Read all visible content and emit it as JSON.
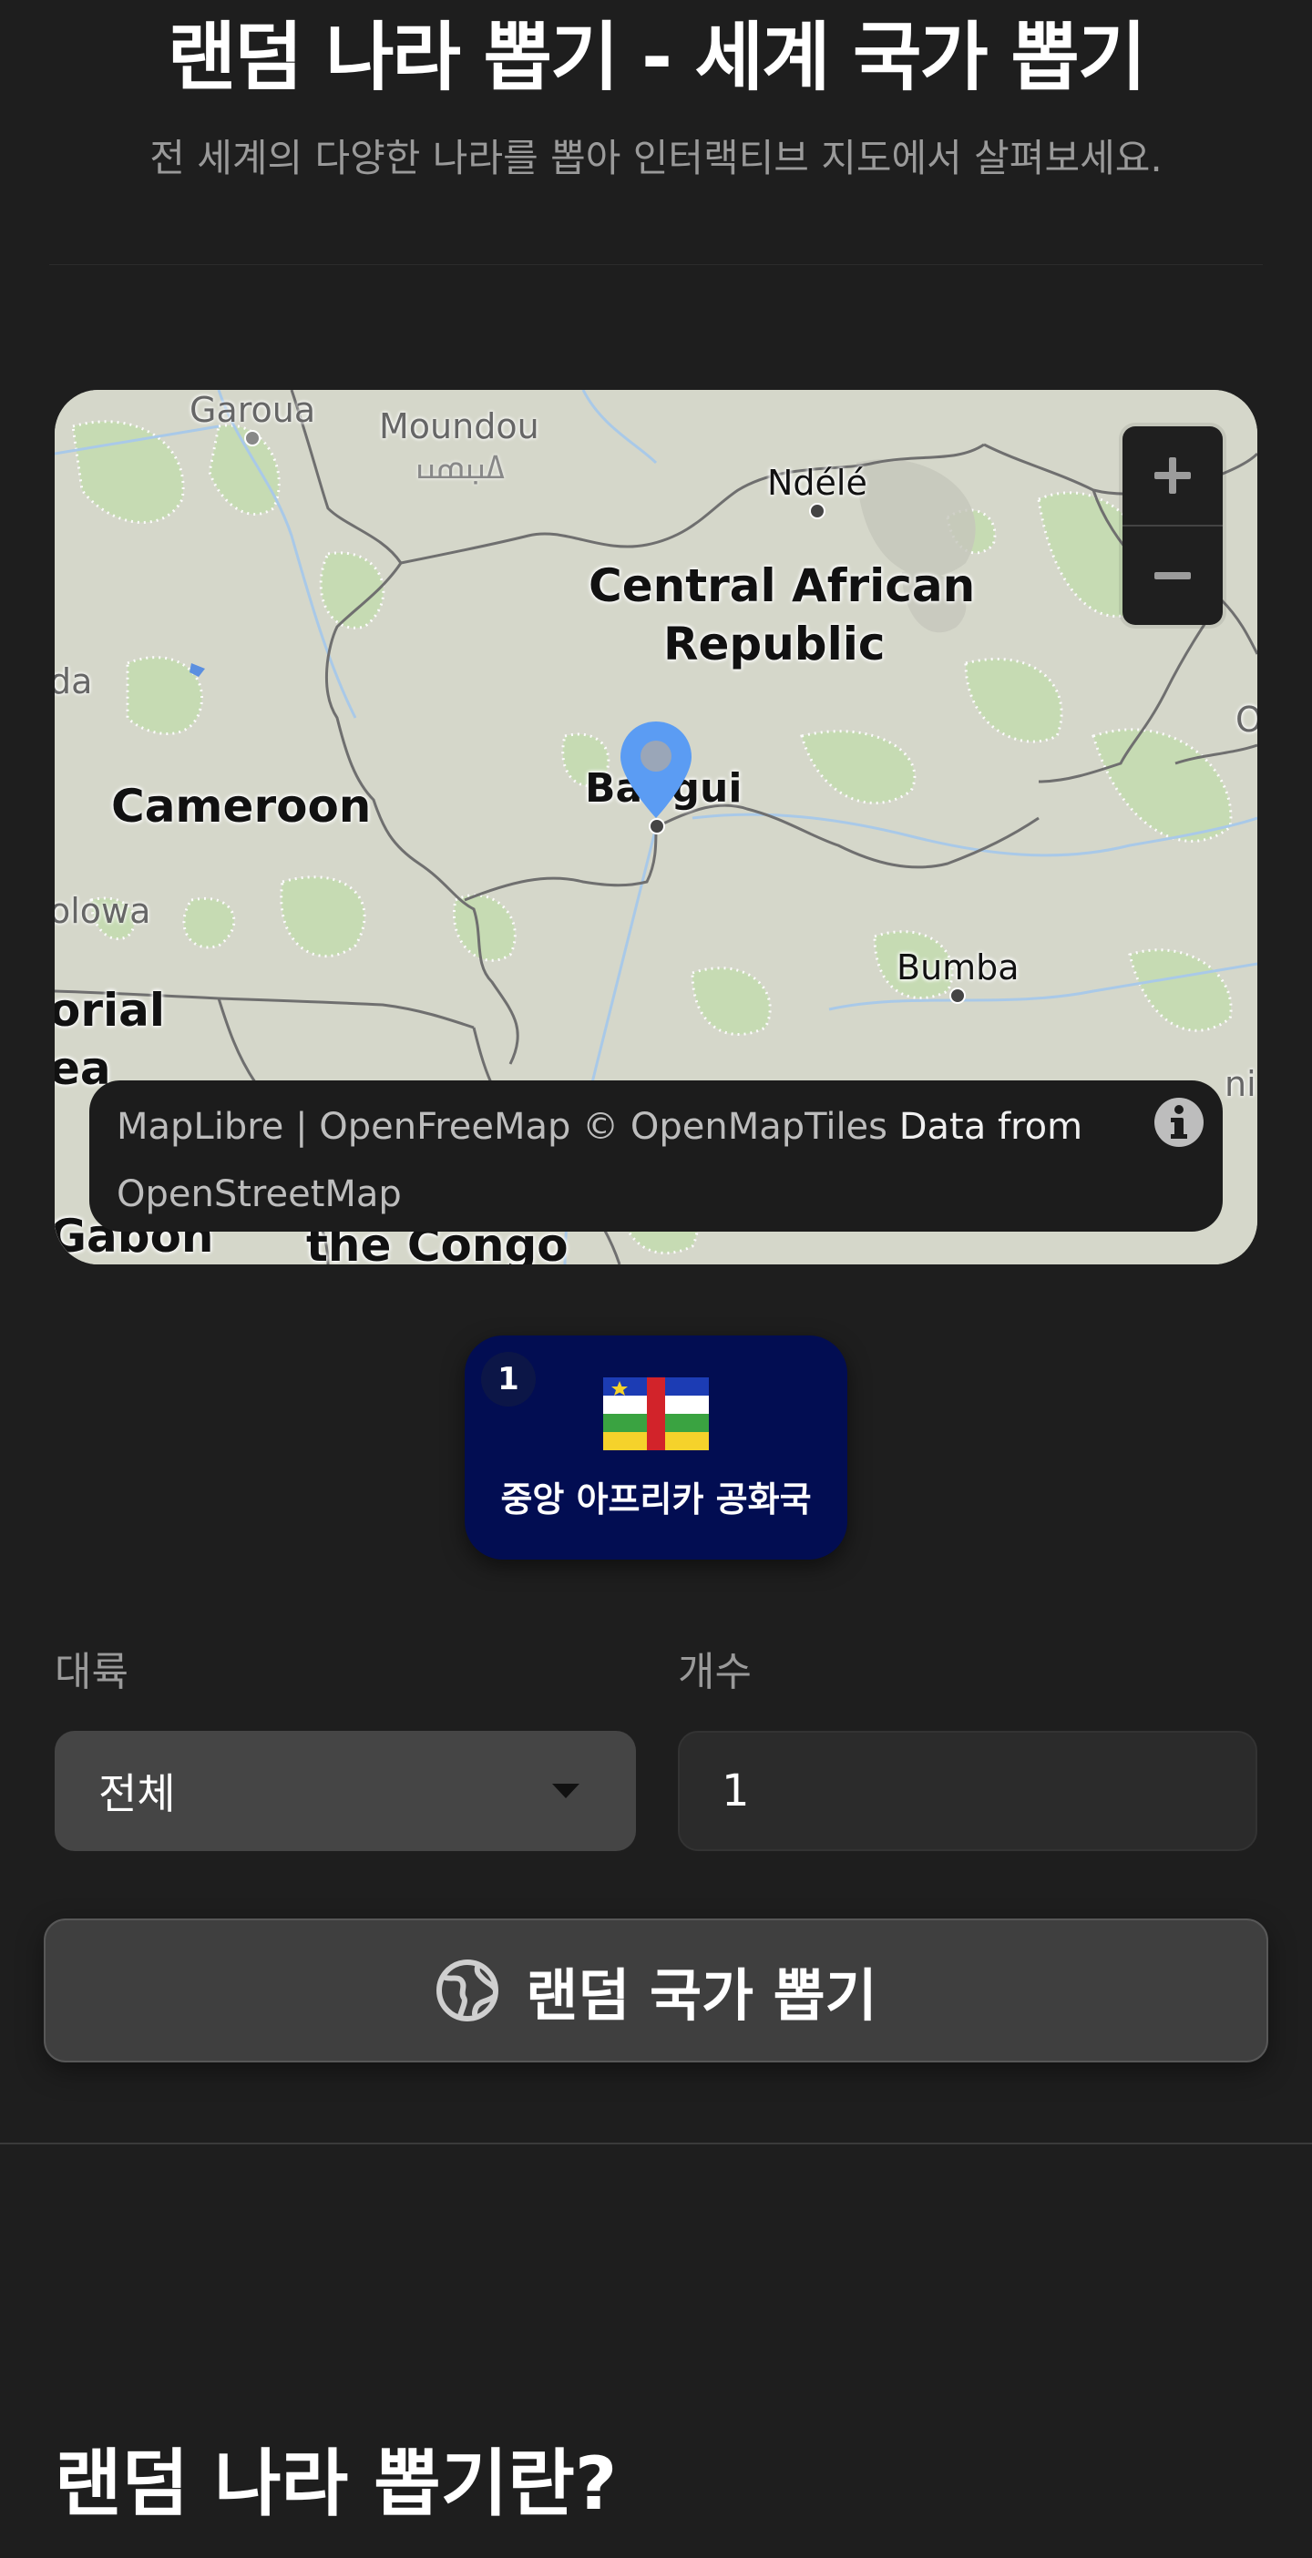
{
  "header": {
    "title": "랜덤 나라 뽑기 - 세계 국가 뽑기",
    "subtitle": "전 세계의 다양한 나라를 뽑아 인터랙티브 지도에서 살펴보세요."
  },
  "map": {
    "countries": {
      "car_line1": "Central African",
      "car_line2": "Republic",
      "cameroon": "Cameroon",
      "equatorial_line1": "orial",
      "equatorial_line2": "ea",
      "gabon": "Gabon",
      "congo": "the Congo"
    },
    "cities": {
      "garoua": "Garoua",
      "moundou": "Moundou",
      "moundou_script": "ߡߎ߲ߘߎ",
      "ndele": "Ndélé",
      "bangui": "Bangui",
      "bumba": "Bumba",
      "olowa": "olowa",
      "da": "da",
      "edge_o": "O",
      "edge_ni": "ni"
    },
    "zoom_in_icon": "plus-icon",
    "zoom_out_icon": "minus-icon",
    "attribution": {
      "maplibre": "MapLibre",
      "sep": " | ",
      "openfreemap": "OpenFreeMap",
      "openmaptiles": "© OpenMapTiles",
      "data_from": "Data from",
      "osm": "OpenStreetMap"
    },
    "marker_color": "#5b9cf3"
  },
  "result": {
    "index": "1",
    "flag_icon": "central-african-republic-flag-icon",
    "name": "중앙 아프리카 공화국",
    "card_color": "#020d52"
  },
  "form": {
    "continent_label": "대륙",
    "continent_value": "전체",
    "count_label": "개수",
    "count_value": "1"
  },
  "draw_button": {
    "icon": "globe-icon",
    "label": "랜덤 국가 뽑기"
  },
  "section": {
    "title": "랜덤 나라 뽑기란?"
  }
}
